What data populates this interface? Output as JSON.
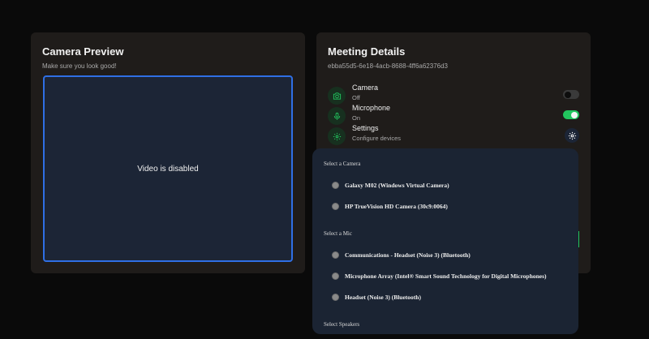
{
  "preview": {
    "title": "Camera Preview",
    "subtitle": "Make sure you look good!",
    "video_status": "Video is disabled"
  },
  "meeting": {
    "title": "Meeting Details",
    "id": "ebba55d5-6e18-4acb-8688-4ff6a62376d3",
    "settings": [
      {
        "label": "Camera",
        "state": "Off",
        "icon": "camera-icon",
        "control": "toggle",
        "enabled": false
      },
      {
        "label": "Microphone",
        "state": "On",
        "icon": "microphone-icon",
        "control": "toggle",
        "enabled": true
      },
      {
        "label": "Settings",
        "state": "Configure devices",
        "icon": "gear-icon",
        "control": "gear-button"
      }
    ]
  },
  "device_menu": {
    "camera_heading": "Select a Camera",
    "cameras": [
      "Galaxy M02 (Windows Virtual Camera)",
      "HP TrueVision HD Camera (30c9:0064)"
    ],
    "mic_heading": "Select a Mic",
    "mics": [
      "Communications - Headset (Noise 3) (Bluetooth)",
      "Microphone Array (Intel® Smart Sound Technology for Digital Microphones)",
      "Headset (Noise 3) (Bluetooth)"
    ],
    "speaker_heading": "Select Speakers"
  },
  "colors": {
    "accent_green": "#22c55e",
    "preview_border": "#2f6fe4",
    "card_bg": "#1f1c1a",
    "menu_bg": "#1b2433"
  }
}
